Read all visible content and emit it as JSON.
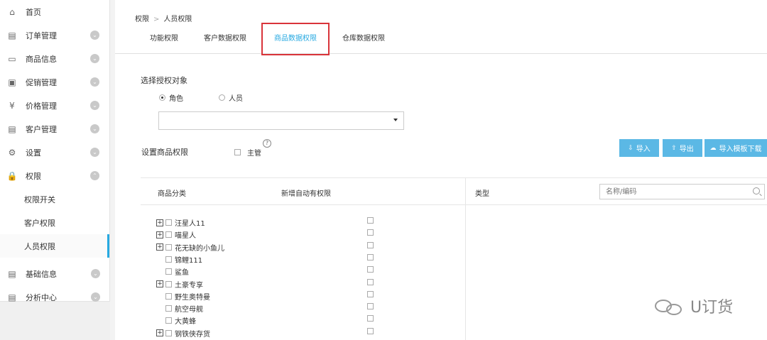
{
  "sidebar": {
    "items": [
      {
        "icon": "home-icon",
        "glyph": "⌂",
        "label": "首页",
        "chevron": ""
      },
      {
        "icon": "clipboard-icon",
        "glyph": "▤",
        "label": "订单管理",
        "chevron": "⌄"
      },
      {
        "icon": "box-icon",
        "glyph": "▭",
        "label": "商品信息",
        "chevron": "⌄"
      },
      {
        "icon": "ticket-icon",
        "glyph": "▣",
        "label": "促销管理",
        "chevron": "⌄"
      },
      {
        "icon": "yen-icon",
        "glyph": "¥",
        "label": "价格管理",
        "chevron": "⌄"
      },
      {
        "icon": "customer-icon",
        "glyph": "▤",
        "label": "客户管理",
        "chevron": "⌄"
      },
      {
        "icon": "gear-icon",
        "glyph": "⚙",
        "label": "设置",
        "chevron": "⌄"
      },
      {
        "icon": "lock-icon",
        "glyph": "🔒",
        "label": "权限",
        "chevron": "⌃"
      }
    ],
    "sub_items": [
      "权限开关",
      "客户权限",
      "人员权限"
    ],
    "bottom_items": [
      {
        "icon": "document-icon",
        "glyph": "▤",
        "label": "基础信息",
        "chevron": "⌄"
      },
      {
        "icon": "report-icon",
        "glyph": "▤",
        "label": "分析中心",
        "chevron": "⌄"
      }
    ]
  },
  "breadcrumb": {
    "root": "权限",
    "sep": ">",
    "current": "人员权限"
  },
  "tabs": [
    "功能权限",
    "客户数据权限",
    "商品数据权限",
    "仓库数据权限"
  ],
  "auth_object": {
    "label": "选择授权对象",
    "option_role": "角色",
    "option_person": "人员",
    "selected": "角色",
    "select_value": ""
  },
  "product_perm": {
    "label": "设置商品权限",
    "supervisor": "主管",
    "help": "?"
  },
  "buttons": {
    "import": "导入",
    "export": "导出",
    "template": "导入模板下载"
  },
  "grid": {
    "col_category": "商品分类",
    "col_auto": "新增自动有权限",
    "col_type": "类型",
    "search_placeholder": "名称/编码",
    "rows": [
      {
        "label": "汪星人11",
        "expandable": true
      },
      {
        "label": "喵星人",
        "expandable": true
      },
      {
        "label": "花无缺的小鱼儿",
        "expandable": true
      },
      {
        "label": "锦鲤111",
        "expandable": false
      },
      {
        "label": "鲨鱼",
        "expandable": false
      },
      {
        "label": "土豪专享",
        "expandable": true
      },
      {
        "label": "野生奥特曼",
        "expandable": false
      },
      {
        "label": "航空母舰",
        "expandable": false
      },
      {
        "label": "大黄蜂",
        "expandable": false
      },
      {
        "label": "钢铁侠存货",
        "expandable": true
      }
    ]
  },
  "watermark": "U订货"
}
